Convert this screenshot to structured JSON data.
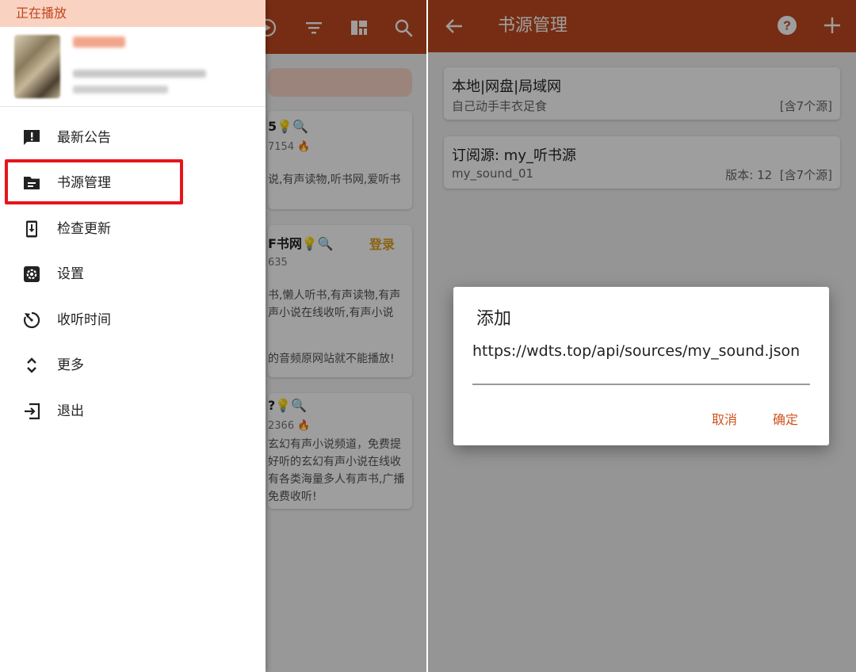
{
  "left": {
    "drawer": {
      "now_playing_label": "正在播放",
      "menu": [
        {
          "label": "最新公告",
          "icon": "announcement-icon"
        },
        {
          "label": "书源管理",
          "icon": "folder-icon"
        },
        {
          "label": "检查更新",
          "icon": "phone-download-icon"
        },
        {
          "label": "设置",
          "icon": "settings-icon"
        },
        {
          "label": "收听时间",
          "icon": "timer-icon"
        },
        {
          "label": "更多",
          "icon": "expand-icon"
        },
        {
          "label": "退出",
          "icon": "exit-icon"
        }
      ],
      "highlighted_item": "书源管理"
    },
    "background": {
      "appbar_icons": [
        "play-icon",
        "filter-icon",
        "layout-icon",
        "search-icon"
      ],
      "cards": [
        {
          "lines": [
            "5💡🔍",
            "7154 🔥",
            "说,有声读物,听书网,爱听书"
          ]
        },
        {
          "title": "F书网💡🔍",
          "login": "登录",
          "lines": [
            "635",
            "书,懒人听书,有声读物,有声",
            "声小说在线收听,有声小说",
            "的音频原网站就不能播放!"
          ]
        },
        {
          "lines": [
            "?💡🔍",
            "2366 🔥",
            "玄幻有声小说频道，免费提",
            "好听的玄幻有声小说在线收",
            "有各类海量多人有声书,广播",
            "免费收听!"
          ]
        }
      ]
    }
  },
  "right": {
    "appbar": {
      "title": "书源管理",
      "back_icon": "back-arrow-icon",
      "help_icon": "help-icon",
      "add_icon": "add-icon"
    },
    "sources": [
      {
        "name": "本地|网盘|局域网",
        "subtitle": "自己动手丰衣足食",
        "version": "",
        "count": "[含7个源]"
      },
      {
        "name": "订阅源: my_听书源",
        "subtitle": "my_sound_01",
        "version": "版本: 12",
        "count": "[含7个源]"
      }
    ],
    "dialog": {
      "title": "添加",
      "input_value": "https://wdts.top/api/sources/my_sound.json",
      "cancel_label": "取消",
      "confirm_label": "确定"
    }
  },
  "colors": {
    "appbar": "#c14a1f",
    "accent": "#d0521f",
    "highlight_box": "#e8141c",
    "now_playing_bg": "#fad2c2"
  }
}
